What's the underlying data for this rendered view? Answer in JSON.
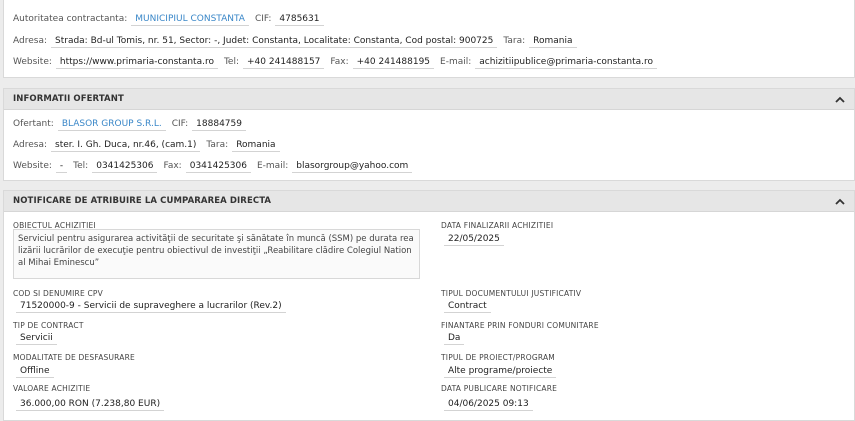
{
  "authority": {
    "contracting_label": "Autoritatea contractanta:",
    "contracting_value": "MUNICIPIUL CONSTANTA",
    "cif_label": "CIF:",
    "cif_value": "4785631",
    "address_label": "Adresa:",
    "address_value": "Strada: Bd-ul Tomis, nr. 51, Sector: -, Judet: Constanta, Localitate: Constanta, Cod postal: 900725",
    "country_label": "Tara:",
    "country_value": "Romania",
    "website_label": "Website:",
    "website_value": "https://www.primaria-constanta.ro",
    "tel_label": "Tel:",
    "tel_value": "+40 241488157",
    "fax_label": "Fax:",
    "fax_value": "+40 241488195",
    "email_label": "E-mail:",
    "email_value": "achizitiipublice@primaria-constanta.ro"
  },
  "offerer": {
    "title": "INFORMATII OFERTANT",
    "offerer_label": "Ofertant:",
    "offerer_value": "BLASOR GROUP S.R.L.",
    "cif_label": "CIF:",
    "cif_value": "18884759",
    "address_label": "Adresa:",
    "address_value": "ster. I. Gh. Duca, nr.46, (cam.1)",
    "country_label": "Tara:",
    "country_value": "Romania",
    "website_label": "Website:",
    "website_value": "-",
    "tel_label": "Tel:",
    "tel_value": "0341425306",
    "fax_label": "Fax:",
    "fax_value": "0341425306",
    "email_label": "E-mail:",
    "email_value": "blasorgroup@yahoo.com"
  },
  "notice": {
    "title": "NOTIFICARE DE ATRIBUIRE LA CUMPARAREA DIRECTA",
    "object_label": "OBIECTUL ACHIZITIEI",
    "object_value": "Serviciul pentru asigurarea activităţii de securitate şi sănătate în muncă (SSM) pe durata realizării lucrărilor de execuţie pentru obiectivul de investiţii „Reabilitare clădire Colegiul National Mihai Eminescu”",
    "finalization_label": "DATA FINALIZARII ACHIZITIEI",
    "finalization_value": "22/05/2025",
    "cpv_label": "COD SI DENUMIRE CPV",
    "cpv_value": "71520000-9 - Servicii de supraveghere a lucrarilor (Rev.2)",
    "doc_type_label": "TIPUL DOCUMENTULUI JUSTIFICATIV",
    "doc_type_value": "Contract",
    "contract_type_label": "TIP DE CONTRACT",
    "contract_type_value": "Servicii",
    "eu_funds_label": "FINANTARE PRIN FONDURI COMUNITARE",
    "eu_funds_value": "Da",
    "mode_label": "MODALITATE DE DESFASURARE",
    "mode_value": "Offline",
    "project_type_label": "TIPUL DE PROIECT/PROGRAM",
    "project_type_value": "Alte programe/proiecte",
    "value_label": "VALOARE ACHIZITIE",
    "value_value": "36.000,00 RON (7.238,80 EUR)",
    "publish_label": "DATA PUBLICARE NOTIFICARE",
    "publish_value": "04/06/2025 09:13"
  },
  "icons": {
    "collapse": "chevron-up-icon"
  }
}
